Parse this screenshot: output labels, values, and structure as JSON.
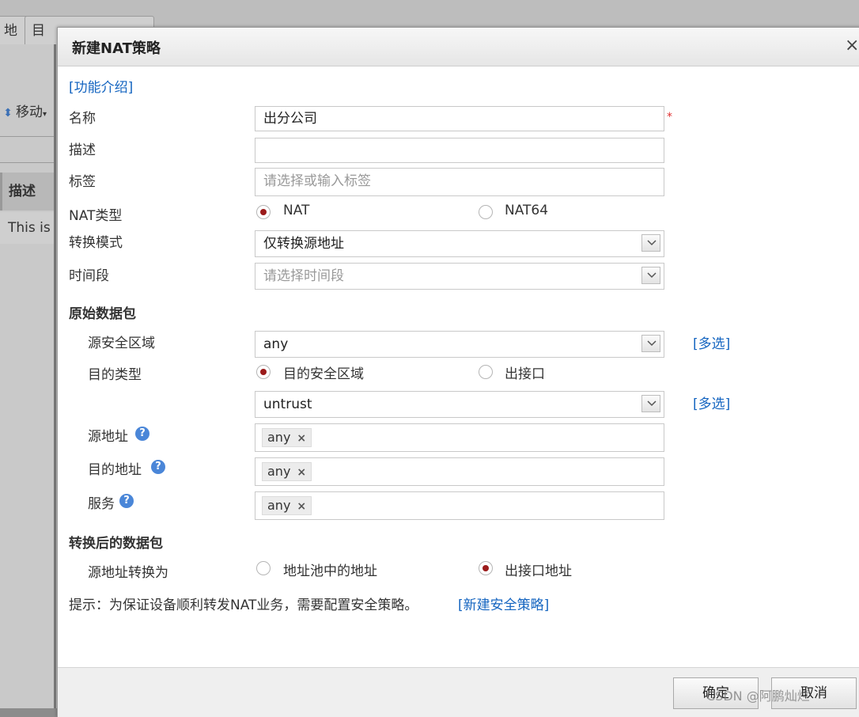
{
  "background": {
    "tabs": [
      "地",
      "目"
    ],
    "toolbar_move": "移动",
    "table_header": "描述",
    "table_row_text": "This is"
  },
  "dialog": {
    "title": "新建NAT策略",
    "close": "×",
    "intro_link": "[功能介绍]",
    "name_label": "名称",
    "name_value": "出分公司",
    "required_mark": "*",
    "desc_label": "描述",
    "desc_value": "",
    "tag_label": "标签",
    "tag_placeholder": "请选择或输入标签",
    "nat_type_label": "NAT类型",
    "nat_type_options": [
      "NAT",
      "NAT64"
    ],
    "nat_type_selected": "NAT",
    "mode_label": "转换模式",
    "mode_value": "仅转换源地址",
    "time_label": "时间段",
    "time_placeholder": "请选择时间段",
    "orig_section": "原始数据包",
    "src_zone_label": "源安全区域",
    "src_zone_value": "any",
    "multi_select": "[多选]",
    "dst_type_label": "目的类型",
    "dst_type_options": [
      "目的安全区域",
      "出接口"
    ],
    "dst_type_selected": "目的安全区域",
    "dst_zone_value": "untrust",
    "src_addr_label": "源地址",
    "src_addr_tag": "any",
    "dst_addr_label": "目的地址",
    "dst_addr_tag": "any",
    "service_label": "服务",
    "service_tag": "any",
    "tag_remove": "×",
    "help": "?",
    "trans_section": "转换后的数据包",
    "src_trans_label": "源地址转换为",
    "src_trans_options": [
      "地址池中的地址",
      "出接口地址"
    ],
    "src_trans_selected": "出接口地址",
    "hint_text": "提示：为保证设备顺利转发NAT业务，需要配置安全策略。",
    "hint_link": "[新建安全策略]",
    "ok_button": "确定",
    "cancel_button": "取消"
  },
  "watermark": "CSDN @阿鹏灿烂"
}
